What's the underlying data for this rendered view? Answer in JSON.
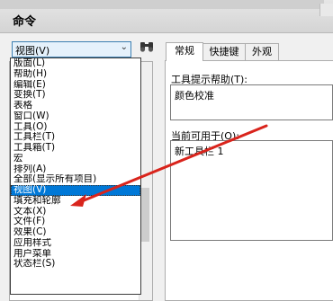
{
  "window": {
    "title": "命令"
  },
  "category_combo": {
    "value": "视图(V)"
  },
  "dropdown": {
    "items": [
      "版面(L)",
      "帮助(H)",
      "编辑(E)",
      "变换(T)",
      "表格",
      "窗口(W)",
      "工具(O)",
      "工具栏(T)",
      "工具箱(T)",
      "宏",
      "排列(A)",
      "全部(显示所有项目)",
      "视图(V)",
      "填充和轮廓",
      "文本(X)",
      "文件(F)",
      "效果(C)",
      "应用样式",
      "用户菜单",
      "状态栏(S)"
    ],
    "selected_index": 12
  },
  "tabs": [
    {
      "label": "常规",
      "active": true
    },
    {
      "label": "快捷键",
      "active": false
    },
    {
      "label": "外观",
      "active": false
    }
  ],
  "general": {
    "tooltip_label": "工具提示帮助(T):",
    "tooltip_value": "颜色校准",
    "available_label": "当前可用于(O):",
    "available_value": "新工具栏 1"
  },
  "colors": {
    "selection": "#0078d7",
    "annotation_arrow": "#d9241c"
  }
}
